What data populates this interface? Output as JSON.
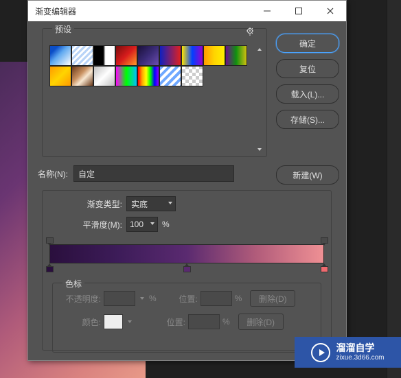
{
  "window": {
    "title": "渐变编辑器"
  },
  "presets": {
    "label": "预设",
    "swatches": [
      "linear-gradient(135deg,#0a4dc7 0%,#0a4dc7 20%,#5ea8f0 45%,#ffffff 100%)",
      "repeating-linear-gradient(135deg,#b9d4f7 0,#b9d4f7 3px,#fff 3px,#fff 6px)",
      "linear-gradient(90deg,#000 0%,#000 45%,#fff 55%,#fff 100%)",
      "linear-gradient(135deg,#7a0d0d,#d81c1c,#ff9c2a)",
      "linear-gradient(135deg,#1a103a,#3a2b76,#6c4db1)",
      "linear-gradient(90deg,#1020c0,#e02020)",
      "linear-gradient(90deg,#ffe600,#0040ff,#9400d3)",
      "linear-gradient(90deg,#ff9a00,#ffd400,#ffee00)",
      "linear-gradient(90deg,#6b0f8a,#109010,#d0c010)",
      "linear-gradient(135deg,#ff9a00,#ffd400,#ff9a00)",
      "linear-gradient(135deg,#6b3a1a 0%,#c89060 40%,#f7e6d0 60%,#6b3a1a 100%)",
      "linear-gradient(135deg,#c0c0c0,#fff,#c0c0c0)",
      "linear-gradient(90deg,#ff00ff,#00ff00,#00bfff)",
      "linear-gradient(90deg,#ff0000,#ffa500,#ffff00,#00ff00,#0000ff,#8b00ff)",
      "repeating-linear-gradient(135deg,#6fa8ff 0,#6fa8ff 4px,#fff 4px,#fff 8px)",
      "repeating-conic-gradient(#ccc 0% 25%,#fff 0% 50%) 50%/10px 10px"
    ]
  },
  "buttons": {
    "ok": "确定",
    "reset": "复位",
    "load": "载入(L)...",
    "save": "存储(S)...",
    "new": "新建(W)"
  },
  "name": {
    "label": "名称(N):",
    "value": "自定"
  },
  "gradient": {
    "type_label": "渐变类型:",
    "type_value": "实底",
    "smooth_label": "平滑度(M):",
    "smooth_value": "100",
    "percent": "%",
    "opacity_stops": [
      0,
      100
    ],
    "color_stops": [
      {
        "pos": 0,
        "color": "#2a0f3d"
      },
      {
        "pos": 50,
        "color": "#5a2a70"
      },
      {
        "pos": 100,
        "color": "#ef6a6f"
      }
    ]
  },
  "stops_panel": {
    "label": "色标",
    "opacity_label": "不透明度:",
    "color_label": "颜色:",
    "position_label": "位置:",
    "percent": "%",
    "delete": "删除(D)"
  },
  "watermark": {
    "t1": "溜溜自学",
    "t2": "zixue.3d66.com"
  },
  "chart_data": {
    "type": "gradient",
    "stops": [
      {
        "position": 0,
        "color": "#2a0f3d"
      },
      {
        "position": 50,
        "color": "#5a2a70"
      },
      {
        "position": 100,
        "color": "#ef9094"
      }
    ],
    "opacity_stops": [
      {
        "position": 0,
        "opacity": 100
      },
      {
        "position": 100,
        "opacity": 100
      }
    ],
    "smoothness_percent": 100
  }
}
